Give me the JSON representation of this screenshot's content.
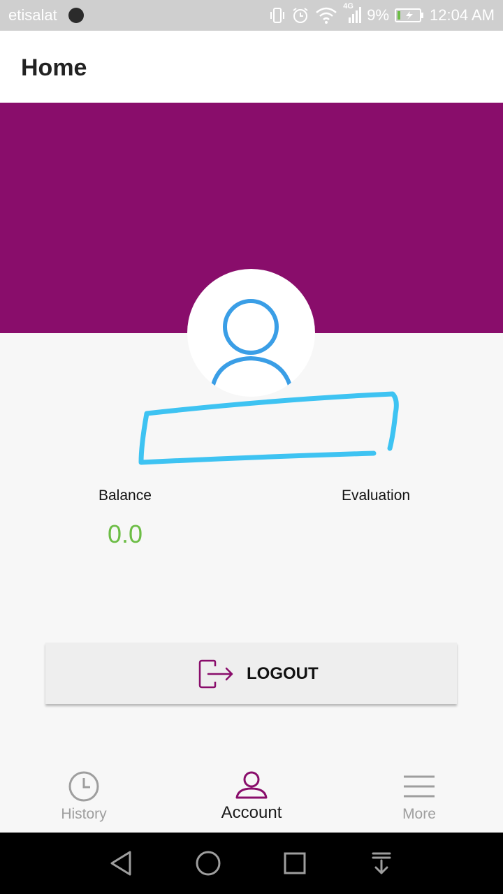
{
  "status_bar": {
    "carrier": "etisalat",
    "network": "4G",
    "battery": "9%",
    "time": "12:04 AM",
    "icons": [
      "vibrate-icon",
      "alarm-icon",
      "wifi-icon",
      "signal-icon",
      "battery-charging-icon"
    ]
  },
  "app_bar": {
    "title": "Home"
  },
  "colors": {
    "header": "#890d6b",
    "accent": "#890d6b",
    "avatar_icon": "#3a9ee6",
    "balance": "#6cbd45",
    "redaction": "#3ec3f2"
  },
  "profile": {
    "avatar_icon": "person-icon"
  },
  "stats": {
    "balance_label": "Balance",
    "balance_value": "0.0",
    "evaluation_label": "Evaluation"
  },
  "logout": {
    "label": "LOGOUT",
    "icon": "logout-icon"
  },
  "tabs": [
    {
      "label": "History",
      "icon": "clock-icon",
      "active": false
    },
    {
      "label": "Account",
      "icon": "person-icon",
      "active": true
    },
    {
      "label": "More",
      "icon": "menu-icon",
      "active": false
    }
  ],
  "system_nav": [
    "back-icon",
    "home-icon",
    "recents-icon",
    "notification-pull-icon"
  ]
}
